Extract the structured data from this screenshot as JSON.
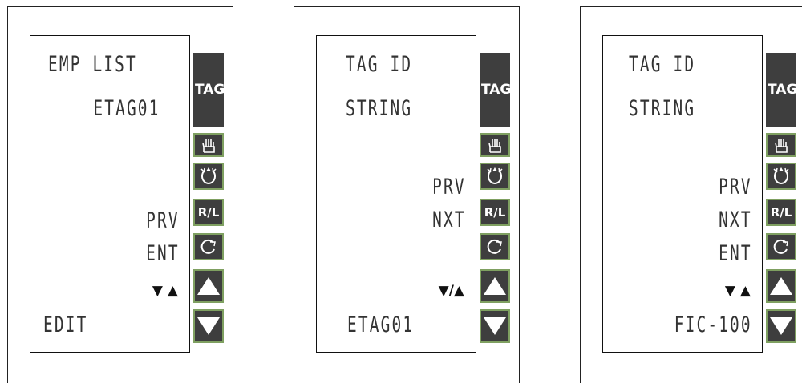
{
  "panels": [
    {
      "lines": {
        "line1": "EMP LIST",
        "line2": "ETAG01",
        "prv": "PRV",
        "ent": "ENT",
        "arrows": "▼ ▲",
        "bottom": "EDIT"
      }
    },
    {
      "lines": {
        "line1": "TAG ID",
        "line2": "STRING",
        "prv": "PRV",
        "nxt": "NXT",
        "arrows": "▼/▲",
        "bottom": "ETAG01"
      }
    },
    {
      "lines": {
        "line1": "TAG ID",
        "line2": "STRING",
        "prv": "PRV",
        "nxt": "NXT",
        "ent": "ENT",
        "arrows": "▼ ▲",
        "bottom": "FIC-100"
      }
    }
  ],
  "buttons": {
    "tag_label": "TAG",
    "rl_label": "R/L"
  },
  "colors": {
    "button_fill": "#3e3e3e",
    "button_border": "#7fa061"
  }
}
